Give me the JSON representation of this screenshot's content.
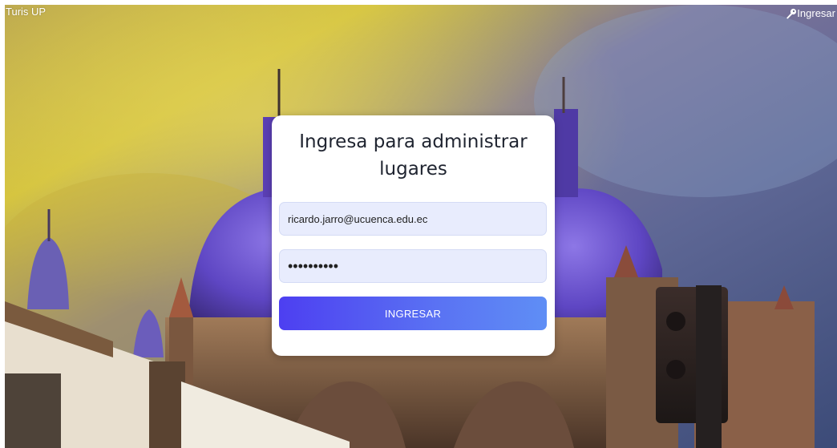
{
  "header": {
    "brand": "Turis UP",
    "login_link": "Ingresar",
    "login_icon": "key-icon"
  },
  "login_card": {
    "title": "Ingresa para administrar lugares",
    "email_value": "ricardo.jarro@ucuenca.edu.ec",
    "password_value": "••••••••••",
    "submit_label": "INGRESAR"
  },
  "background": {
    "image": "cathedral-domes-photo"
  },
  "colors": {
    "card_bg": "#ffffff",
    "input_bg": "#e8ecfd",
    "button_gradient_start": "#4d3ff1",
    "button_gradient_end": "#5f8ef5"
  }
}
